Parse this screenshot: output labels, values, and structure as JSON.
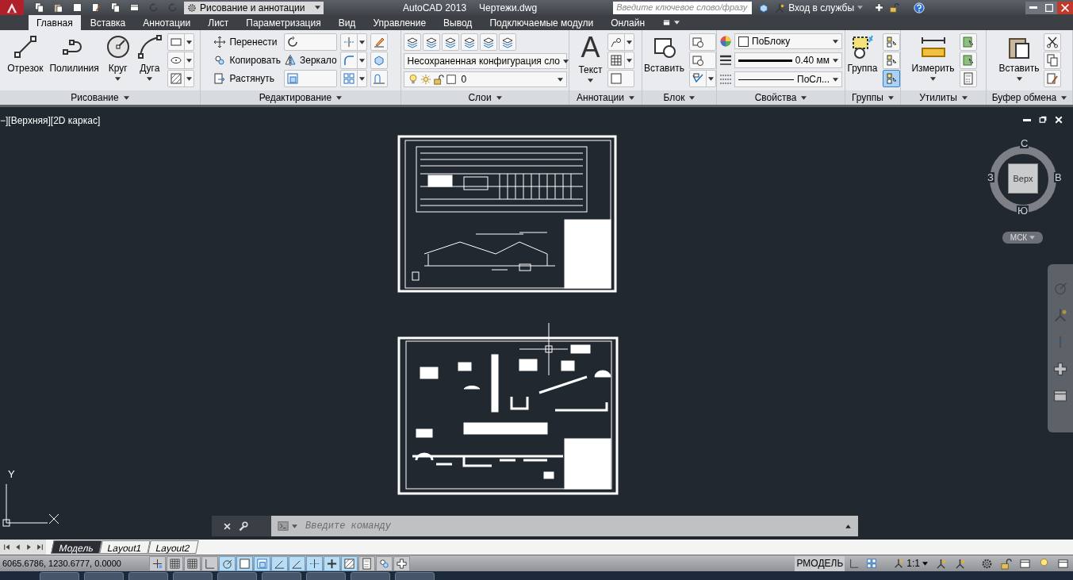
{
  "title_bar": {
    "workspace": "Рисование и аннотации",
    "app_title": "AutoCAD 2013",
    "file_name": "Чертежи.dwg",
    "search": {
      "placeholder": "Введите ключевое слово/фразу"
    },
    "sign_in": "Вход в службы"
  },
  "ribbon_tabs": [
    {
      "label": "Главная",
      "selected": true
    },
    {
      "label": "Вставка",
      "selected": false
    },
    {
      "label": "Аннотации",
      "selected": false
    },
    {
      "label": "Лист",
      "selected": false
    },
    {
      "label": "Параметризация",
      "selected": false
    },
    {
      "label": "Вид",
      "selected": false
    },
    {
      "label": "Управление",
      "selected": false
    },
    {
      "label": "Вывод",
      "selected": false
    },
    {
      "label": "Подключаемые модули",
      "selected": false
    },
    {
      "label": "Онлайн",
      "selected": false
    }
  ],
  "ribbon_panels": [
    {
      "title": "Рисование",
      "items": [
        {
          "kind": "large",
          "label": "Отрезок",
          "dropdown": false
        },
        {
          "kind": "large",
          "label": "Полилиния",
          "dropdown": false
        },
        {
          "kind": "large",
          "label": "Круг",
          "dropdown": true
        },
        {
          "kind": "large",
          "label": "Дуга",
          "dropdown": true
        },
        {
          "kind": "stack",
          "items": [
            {
              "kind": "icon",
              "dropdown": true
            },
            {
              "kind": "icon",
              "dropdown": true
            },
            {
              "kind": "icon",
              "dropdown": true
            }
          ]
        }
      ]
    },
    {
      "title": "Редактирование",
      "items": [
        {
          "kind": "stack",
          "items": [
            {
              "kind": "small",
              "label": "Перенести"
            },
            {
              "kind": "small",
              "label": "Копировать"
            },
            {
              "kind": "small",
              "label": "Растянуть"
            }
          ]
        },
        {
          "kind": "stack",
          "items": [
            {
              "kind": "icon",
              "dropdown": false
            },
            {
              "kind": "small",
              "label": "Зеркало"
            },
            {
              "kind": "icon",
              "dropdown": false
            }
          ]
        },
        {
          "kind": "stack",
          "items": [
            {
              "kind": "icon",
              "dropdown": true
            },
            {
              "kind": "icon",
              "dropdown": true
            },
            {
              "kind": "icon",
              "dropdown": true
            }
          ]
        },
        {
          "kind": "stack",
          "items": [
            {
              "kind": "icon",
              "dropdown": false
            },
            {
              "kind": "icon",
              "dropdown": false
            },
            {
              "kind": "icon",
              "dropdown": false
            }
          ]
        }
      ]
    },
    {
      "title": "Слои",
      "items": [
        {
          "kind": "stack",
          "items": [
            {
              "kind": "row",
              "items": [
                {
                  "kind": "icon",
                  "dropdown": false
                },
                {
                  "kind": "icon",
                  "dropdown": false
                },
                {
                  "kind": "icon",
                  "dropdown": false
                },
                {
                  "kind": "icon",
                  "dropdown": false
                },
                {
                  "kind": "icon",
                  "dropdown": false
                },
                {
                  "kind": "icon",
                  "dropdown": false
                }
              ]
            },
            {
              "kind": "combo",
              "value": "Несохраненная конфигурация сло"
            },
            {
              "kind": "layer_combo",
              "value": "0"
            }
          ]
        }
      ]
    },
    {
      "title": "Аннотации",
      "items": [
        {
          "kind": "large",
          "label": "Текст",
          "glyph": "A",
          "dropdown": true
        },
        {
          "kind": "stack",
          "items": [
            {
              "kind": "icon",
              "dropdown": true
            },
            {
              "kind": "icon",
              "dropdown": true
            },
            {
              "kind": "icon",
              "dropdown": false
            }
          ]
        }
      ]
    },
    {
      "title": "Блок",
      "items": [
        {
          "kind": "large",
          "label": "Вставить",
          "dropdown": false
        },
        {
          "kind": "stack",
          "items": [
            {
              "kind": "icon",
              "dropdown": false
            },
            {
              "kind": "icon",
              "dropdown": false
            },
            {
              "kind": "icon",
              "dropdown": true
            }
          ]
        }
      ]
    },
    {
      "title": "Свойства",
      "items": [
        {
          "kind": "stack",
          "items": [
            {
              "kind": "color_combo",
              "value": "ПоБлоку"
            },
            {
              "kind": "lineweight_combo",
              "value": "0.40 мм"
            },
            {
              "kind": "linetype_combo",
              "value": "ПоСл..."
            }
          ]
        }
      ]
    },
    {
      "title": "Группы",
      "items": [
        {
          "kind": "large",
          "label": "Группа",
          "dropdown": false
        },
        {
          "kind": "stack",
          "items": [
            {
              "kind": "toggle",
              "on": false
            },
            {
              "kind": "toggle",
              "on": false
            },
            {
              "kind": "toggle",
              "on": true
            }
          ]
        }
      ]
    },
    {
      "title": "Утилиты",
      "items": [
        {
          "kind": "large",
          "label": "Измерить",
          "dropdown": true
        },
        {
          "kind": "stack",
          "items": [
            {
              "kind": "icon",
              "dropdown": false
            },
            {
              "kind": "icon",
              "dropdown": false
            },
            {
              "kind": "icon",
              "dropdown": false
            }
          ]
        }
      ]
    },
    {
      "title": "Буфер обмена",
      "items": [
        {
          "kind": "large",
          "label": "Вставить",
          "dropdown": true
        },
        {
          "kind": "stack",
          "items": [
            {
              "kind": "icon",
              "dropdown": false
            },
            {
              "kind": "icon",
              "dropdown": false
            },
            {
              "kind": "icon",
              "dropdown": false
            }
          ]
        }
      ]
    }
  ],
  "viewport": {
    "label": "−][Верхняя][2D каркас]",
    "viewcube": {
      "face": "Верх",
      "north": "С",
      "west": "З",
      "east": "В",
      "south": "Ю",
      "ucs": "МСК"
    },
    "ucs_axis": {
      "y": "Y"
    }
  },
  "command_line": {
    "placeholder": "Введите команду"
  },
  "layout_tabs": [
    {
      "label": "Модель",
      "selected": true
    },
    {
      "label": "Layout1",
      "selected": false
    },
    {
      "label": "Layout2",
      "selected": false
    }
  ],
  "status_bar": {
    "coordinates": "6065.6786, 1230.6777, 0.0000",
    "toggles": [
      {
        "on": false
      },
      {
        "on": false
      },
      {
        "on": false
      },
      {
        "on": false
      },
      {
        "on": true
      },
      {
        "on": true
      },
      {
        "on": true
      },
      {
        "on": true
      },
      {
        "on": true
      },
      {
        "on": true
      },
      {
        "on": true
      },
      {
        "on": true
      },
      {
        "on": false
      },
      {
        "on": false
      },
      {
        "on": false
      }
    ],
    "space": "РМОДЕЛЬ",
    "scale": "1:1"
  }
}
